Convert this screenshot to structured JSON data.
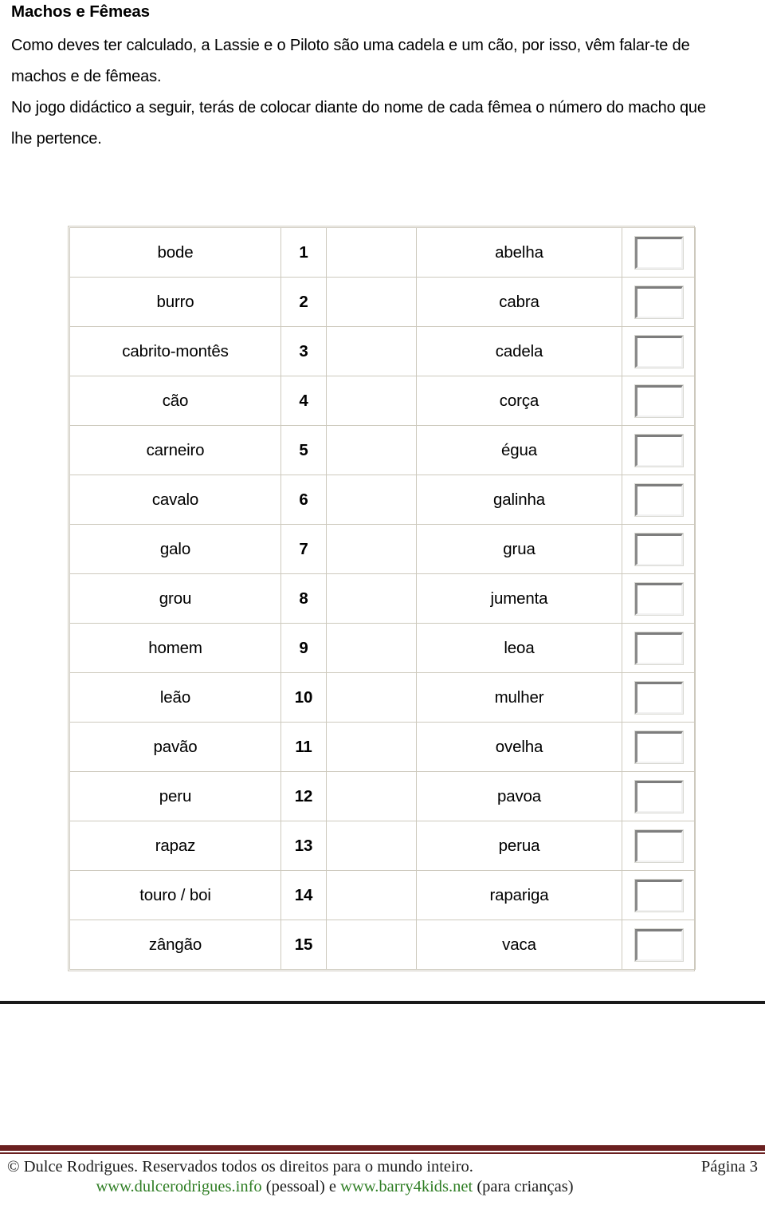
{
  "document": {
    "title": "Machos e Fêmeas",
    "paragraphs": [
      "Como deves ter calculado, a Lassie e o Piloto são uma cadela e um cão, por isso, vêm falar-te de machos e de fêmeas.",
      "No jogo didáctico a seguir, terás de colocar diante do nome de cada fêmea o número do macho que lhe pertence."
    ]
  },
  "exercise": {
    "rows": [
      {
        "male": "bode",
        "number": "1",
        "blank": "",
        "female": "abelha",
        "answer": ""
      },
      {
        "male": "burro",
        "number": "2",
        "blank": "",
        "female": "cabra",
        "answer": ""
      },
      {
        "male": "cabrito-montês",
        "number": "3",
        "blank": "",
        "female": "cadela",
        "answer": ""
      },
      {
        "male": "cão",
        "number": "4",
        "blank": "",
        "female": "corça",
        "answer": ""
      },
      {
        "male": "carneiro",
        "number": "5",
        "blank": "",
        "female": "égua",
        "answer": ""
      },
      {
        "male": "cavalo",
        "number": "6",
        "blank": "",
        "female": "galinha",
        "answer": ""
      },
      {
        "male": "galo",
        "number": "7",
        "blank": "",
        "female": "grua",
        "answer": ""
      },
      {
        "male": "grou",
        "number": "8",
        "blank": "",
        "female": "jumenta",
        "answer": ""
      },
      {
        "male": "homem",
        "number": "9",
        "blank": "",
        "female": "leoa",
        "answer": ""
      },
      {
        "male": "leão",
        "number": "10",
        "blank": "",
        "female": "mulher",
        "answer": ""
      },
      {
        "male": "pavão",
        "number": "11",
        "blank": "",
        "female": "ovelha",
        "answer": ""
      },
      {
        "male": "peru",
        "number": "12",
        "blank": "",
        "female": "pavoa",
        "answer": ""
      },
      {
        "male": "rapaz",
        "number": "13",
        "blank": "",
        "female": "perua",
        "answer": ""
      },
      {
        "male": "touro / boi",
        "number": "14",
        "blank": "",
        "female": "rapariga",
        "answer": ""
      },
      {
        "male": "zângão",
        "number": "15",
        "blank": "",
        "female": "vaca",
        "answer": ""
      }
    ]
  },
  "footer": {
    "copyright": "© Dulce Rodrigues. Reservados todos os direitos para o mundo inteiro.",
    "page_label": "Página 3",
    "credits": {
      "url_personal": "www.dulcerodrigues.info",
      "personal_note": "(pessoal) e",
      "url_kids": "www.barry4kids.net",
      "kids_note": "(para crianças)"
    }
  },
  "colors": {
    "rule_maroon": "#6b2020",
    "url_green": "#2e7d23",
    "cell_border": "#cdc9bd",
    "divider_black": "#1a1a1a"
  }
}
